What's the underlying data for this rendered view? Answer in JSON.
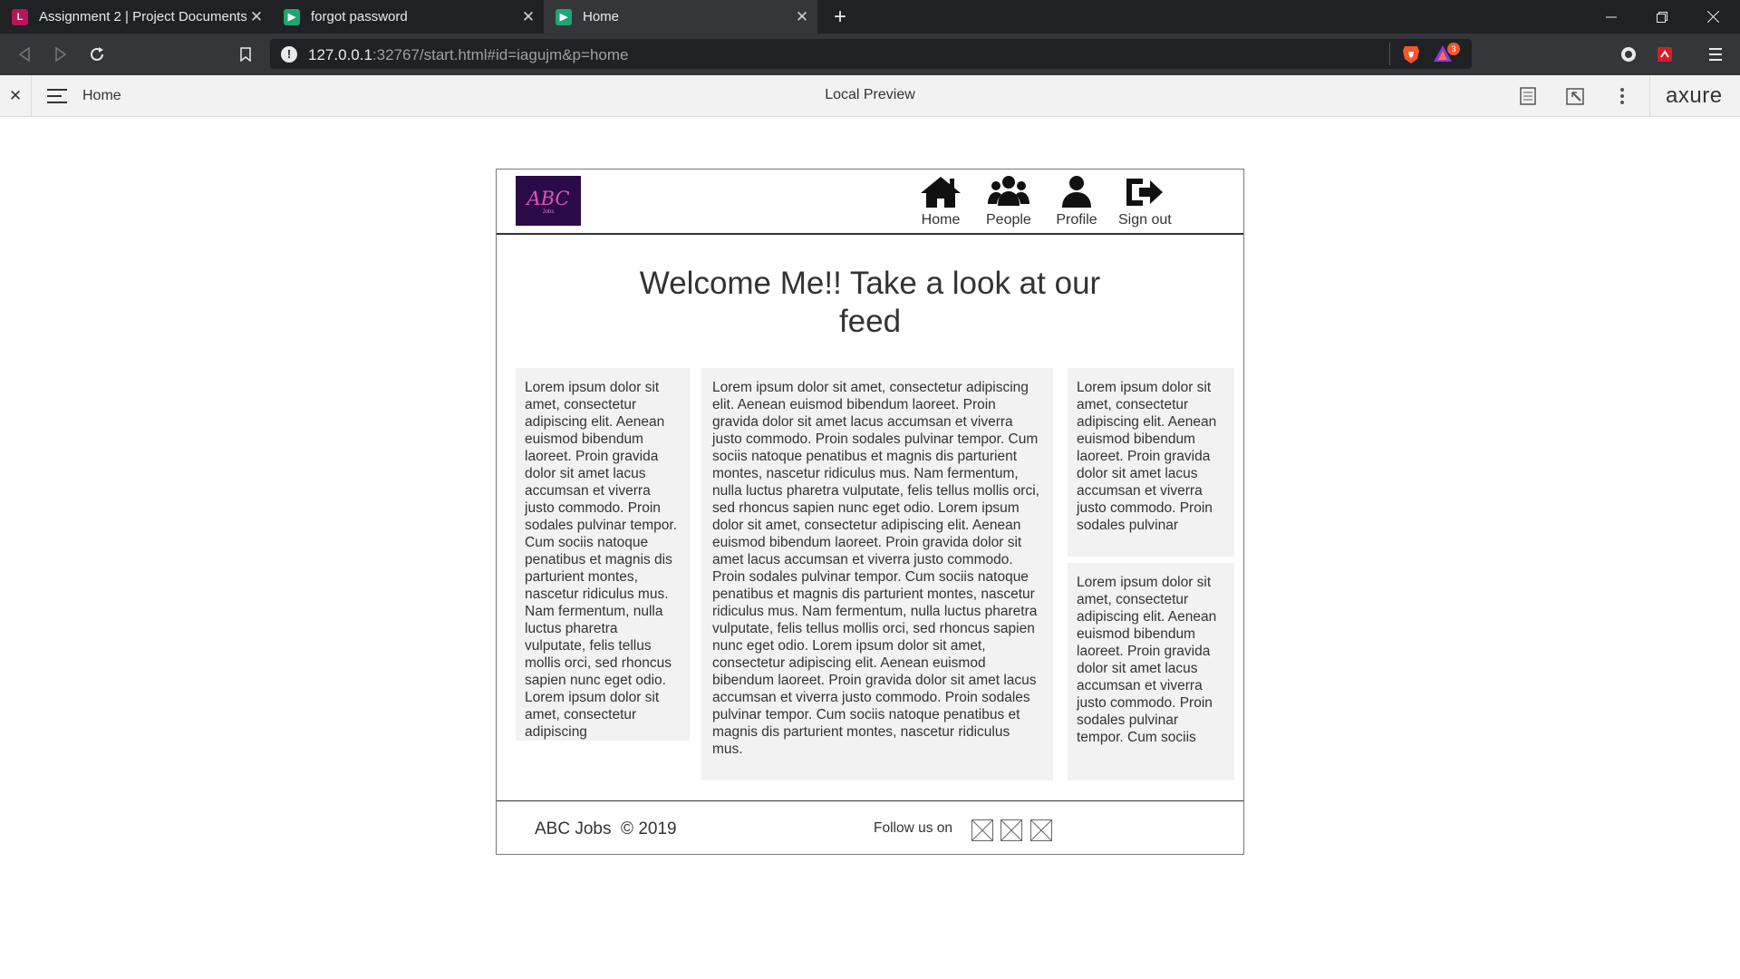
{
  "browser": {
    "tabs": [
      {
        "favicon": "L",
        "favicon_color": "#b5175a",
        "title": "Assignment 2 | Project Documents",
        "close": "✕"
      },
      {
        "favicon": "▶",
        "favicon_color": "#1ea672",
        "title": "forgot password",
        "close": "✕"
      },
      {
        "favicon": "▶",
        "favicon_color": "#1ea672",
        "title": "Home",
        "close": "✕"
      }
    ],
    "new_tab": "+",
    "url_host": "127.0.0.1",
    "url_rest": ":32767/start.html#id=iagujm&p=home",
    "rewards_badge": "3"
  },
  "axure": {
    "close": "✕",
    "page_name": "Home",
    "preview_label": "Local Preview",
    "brand": "axure"
  },
  "prototype": {
    "logo_text": "ABC",
    "logo_sub": "Jobs",
    "nav": [
      {
        "label": "Home",
        "icon": "home-icon"
      },
      {
        "label": "People",
        "icon": "people-icon"
      },
      {
        "label": "Profile",
        "icon": "profile-icon"
      },
      {
        "label": "Sign out",
        "icon": "sign-out-icon"
      }
    ],
    "welcome": "Welcome Me!! Take a look at our feed",
    "cards": {
      "left": "Lorem ipsum dolor sit amet, consectetur adipiscing elit. Aenean euismod bibendum laoreet. Proin gravida dolor sit amet lacus accumsan et viverra justo commodo. Proin sodales pulvinar tempor. Cum sociis natoque penatibus et magnis dis parturient montes, nascetur ridiculus mus. Nam fermentum, nulla luctus pharetra vulputate, felis tellus mollis orci, sed rhoncus sapien nunc eget odio. Lorem ipsum dolor sit amet, consectetur adipiscing",
      "center": "Lorem ipsum dolor sit amet, consectetur adipiscing elit. Aenean euismod bibendum laoreet. Proin gravida dolor sit amet lacus accumsan et viverra justo commodo. Proin sodales pulvinar tempor. Cum sociis natoque penatibus et magnis dis parturient montes, nascetur ridiculus mus. Nam fermentum, nulla luctus pharetra vulputate, felis tellus mollis orci, sed rhoncus sapien nunc eget odio. Lorem ipsum dolor sit amet, consectetur adipiscing elit. Aenean euismod bibendum laoreet. Proin gravida dolor sit amet lacus accumsan et viverra justo commodo. Proin sodales pulvinar tempor. Cum sociis natoque penatibus et magnis dis parturient montes, nascetur ridiculus mus. Nam fermentum, nulla luctus pharetra vulputate, felis tellus mollis orci, sed rhoncus sapien nunc eget odio. Lorem ipsum dolor sit amet, consectetur adipiscing elit. Aenean euismod bibendum laoreet. Proin gravida dolor sit amet lacus accumsan et viverra justo commodo. Proin sodales pulvinar tempor. Cum sociis natoque penatibus et magnis dis parturient montes, nascetur ridiculus mus.",
      "right_top": "Lorem ipsum dolor sit amet, consectetur adipiscing elit. Aenean euismod bibendum laoreet. Proin gravida dolor sit amet lacus accumsan et viverra justo commodo. Proin sodales pulvinar",
      "right_bottom": "Lorem ipsum dolor sit amet, consectetur adipiscing elit. Aenean euismod bibendum laoreet. Proin gravida dolor sit amet lacus accumsan et viverra justo commodo. Proin sodales pulvinar tempor. Cum sociis"
    },
    "footer": {
      "copyright": "ABC Jobs  © 2019",
      "follow": "Follow us on"
    }
  }
}
